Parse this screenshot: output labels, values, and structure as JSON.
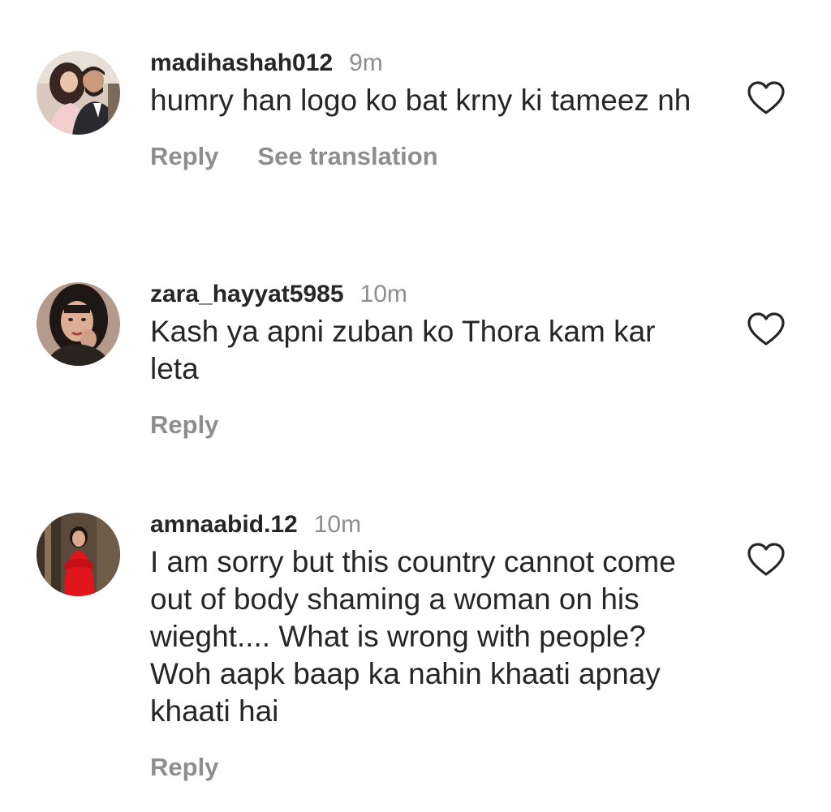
{
  "comments": [
    {
      "username": "madihashah012",
      "time": "9m",
      "text": "humry han logo ko bat krny ki tameez nh",
      "reply_label": "Reply",
      "translate_label": "See translation",
      "like_icon": "heart-outline-icon",
      "avatar": "profile-photo"
    },
    {
      "username": "zara_hayyat5985",
      "time": "10m",
      "text": "Kash ya apni zuban ko Thora kam kar leta",
      "reply_label": "Reply",
      "like_icon": "heart-outline-icon",
      "avatar": "profile-photo"
    },
    {
      "username": "amnaabid.12",
      "time": "10m",
      "text": "I am sorry but this country cannot come out of body shaming a woman on his wieght.... What is wrong with people? Woh aapk baap ka nahin khaati apnay khaati hai",
      "reply_label": "Reply",
      "like_icon": "heart-outline-icon",
      "avatar": "profile-photo"
    }
  ],
  "colors": {
    "text": "#262626",
    "secondary": "#8e8e8e",
    "background": "#ffffff"
  }
}
